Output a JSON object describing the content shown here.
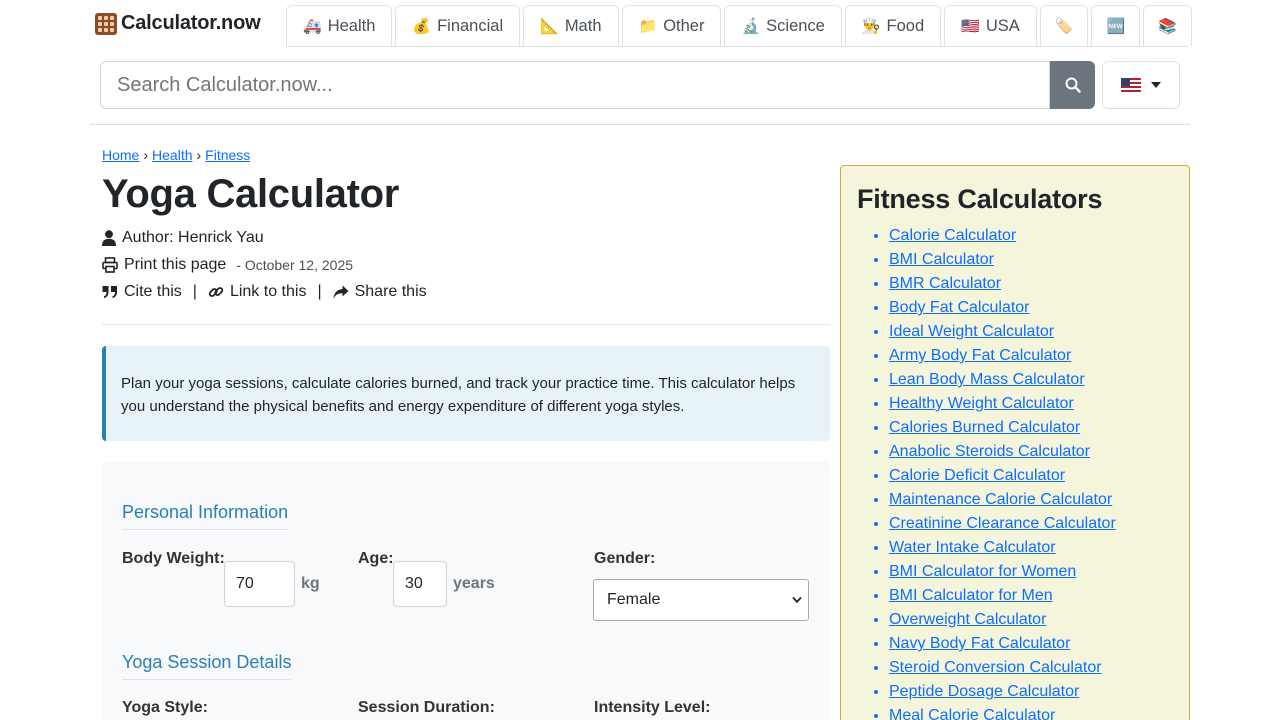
{
  "header": {
    "brand": "Calculator.now",
    "tabs": [
      {
        "emoji": "🚑",
        "label": "Health"
      },
      {
        "emoji": "💰",
        "label": "Financial"
      },
      {
        "emoji": "📐",
        "label": "Math"
      },
      {
        "emoji": "📁",
        "label": "Other"
      },
      {
        "emoji": "🔬",
        "label": "Science"
      },
      {
        "emoji": "👨‍🍳",
        "label": "Food"
      },
      {
        "emoji": "🇺🇸",
        "label": "USA"
      },
      {
        "emoji": "🏷️",
        "label": ""
      },
      {
        "emoji": "🆕",
        "label": ""
      },
      {
        "emoji": "📚",
        "label": ""
      }
    ],
    "search": {
      "placeholder": "Search Calculator.now..."
    }
  },
  "breadcrumb": {
    "home": "Home",
    "health": "Health",
    "fitness": "Fitness",
    "sep": "›"
  },
  "page": {
    "title": "Yoga Calculator",
    "author": "Author: Henrick Yau",
    "print": "Print this page",
    "date": "- October 12, 2025",
    "cite": "Cite this",
    "link": "Link to this",
    "share": "Share this",
    "bar": "|",
    "intro": "Plan your yoga sessions, calculate calories burned, and track your practice time. This calculator helps you understand the physical benefits and energy expenditure of different yoga styles."
  },
  "form": {
    "personal_title": "Personal Information",
    "weight_label": "Body Weight:",
    "weight_value": "70",
    "weight_unit": "kg",
    "age_label": "Age:",
    "age_value": "30",
    "age_unit": "years",
    "gender_label": "Gender:",
    "gender_value": "Female",
    "yoga_title": "Yoga Session Details",
    "style_label": "Yoga Style:",
    "duration_label": "Session Duration:",
    "intensity_label": "Intensity Level:"
  },
  "sidebar": {
    "title": "Fitness Calculators",
    "items": [
      "Calorie Calculator",
      "BMI Calculator",
      "BMR Calculator",
      "Body Fat Calculator",
      "Ideal Weight Calculator",
      "Army Body Fat Calculator",
      "Lean Body Mass Calculator",
      "Healthy Weight Calculator",
      "Calories Burned Calculator",
      "Anabolic Steroids Calculator",
      "Calorie Deficit Calculator",
      "Maintenance Calorie Calculator",
      "Creatinine Clearance Calculator",
      "Water Intake Calculator",
      "BMI Calculator for Women",
      "BMI Calculator for Men",
      "Overweight Calculator",
      "Navy Body Fat Calculator",
      "Steroid Conversion Calculator",
      "Peptide Dosage Calculator",
      "Meal Calorie Calculator"
    ]
  }
}
